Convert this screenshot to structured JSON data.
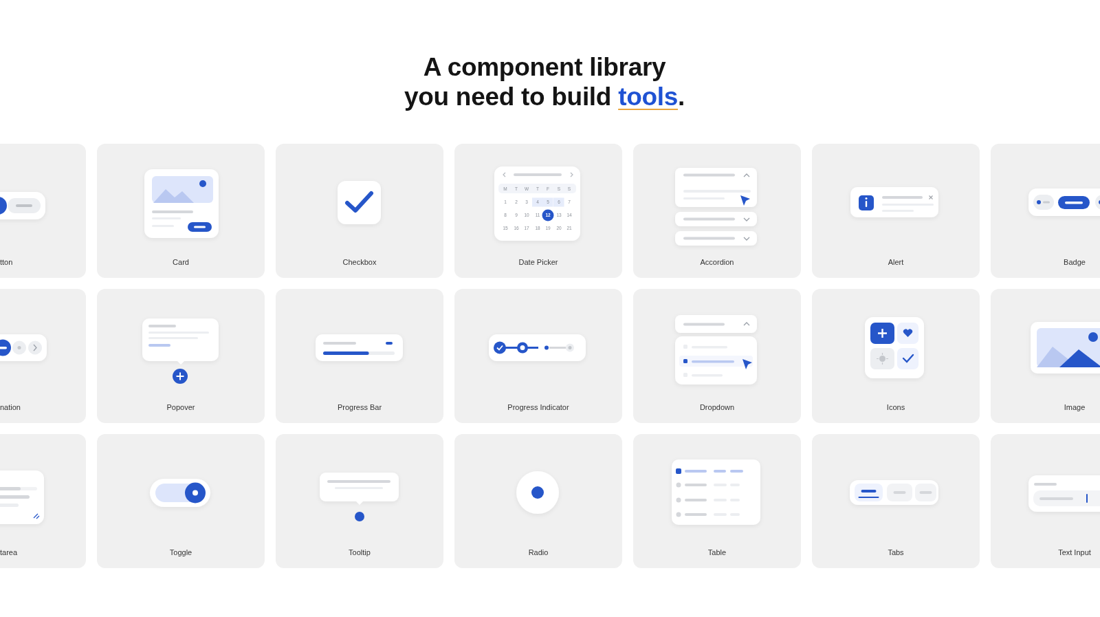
{
  "heading": "A component library\nyou need to build **tools**.",
  "tiles": [
    {
      "label": "tton",
      "kind": "button"
    },
    {
      "label": "Card",
      "kind": "card"
    },
    {
      "label": "Checkbox",
      "kind": "checkbox",
      "checked": true
    },
    {
      "label": "Date Picker",
      "kind": "datepicker",
      "weekdays": [
        "M",
        "T",
        "W",
        "T",
        "F",
        "S",
        "S"
      ],
      "days": [
        {
          "text": "1",
          "selected": false,
          "in_range": false
        },
        {
          "text": "2",
          "selected": false,
          "in_range": false
        },
        {
          "text": "3",
          "selected": false,
          "in_range": false
        },
        {
          "text": "4",
          "selected": false,
          "in_range": true
        },
        {
          "text": "5",
          "selected": false,
          "in_range": true
        },
        {
          "text": "6",
          "selected": false,
          "in_range": true
        },
        {
          "text": "7",
          "selected": false,
          "in_range": false
        },
        {
          "text": "8",
          "selected": false,
          "in_range": false
        },
        {
          "text": "9",
          "selected": false,
          "in_range": false
        },
        {
          "text": "10",
          "selected": false,
          "in_range": false
        },
        {
          "text": "11",
          "selected": false,
          "in_range": false
        },
        {
          "text": "12",
          "selected": true,
          "in_range": false
        },
        {
          "text": "13",
          "selected": false,
          "in_range": false
        },
        {
          "text": "14",
          "selected": false,
          "in_range": false
        },
        {
          "text": "15",
          "selected": false,
          "in_range": false
        },
        {
          "text": "16",
          "selected": false,
          "in_range": false
        },
        {
          "text": "17",
          "selected": false,
          "in_range": false
        },
        {
          "text": "18",
          "selected": false,
          "in_range": false
        },
        {
          "text": "19",
          "selected": false,
          "in_range": false
        },
        {
          "text": "20",
          "selected": false,
          "in_range": false
        },
        {
          "text": "21",
          "selected": false,
          "in_range": false
        }
      ]
    },
    {
      "label": "Accordion",
      "kind": "accordion",
      "sections": [
        {
          "expanded": true
        },
        {
          "expanded": false
        },
        {
          "expanded": false
        }
      ]
    },
    {
      "label": "Alert",
      "kind": "alert"
    },
    {
      "label": "Badge",
      "kind": "badge"
    },
    {
      "label": "nation",
      "kind": "pagination"
    },
    {
      "label": "Popover",
      "kind": "popover"
    },
    {
      "label": "Progress Bar",
      "kind": "progressbar",
      "level": 0.64
    },
    {
      "label": "Progress Indicator",
      "kind": "progressindicator"
    },
    {
      "label": "Dropdown",
      "kind": "dropdown"
    },
    {
      "label": "Icons",
      "kind": "icons"
    },
    {
      "label": "Image",
      "kind": "image"
    },
    {
      "label": "tarea",
      "kind": "textarea"
    },
    {
      "label": "Toggle",
      "kind": "toggle",
      "on": true
    },
    {
      "label": "Tooltip",
      "kind": "tooltip"
    },
    {
      "label": "Radio",
      "kind": "radio",
      "checked": true
    },
    {
      "label": "Table",
      "kind": "table"
    },
    {
      "label": "Tabs",
      "kind": "tabs",
      "tabs": [
        {
          "selected": true
        },
        {
          "selected": false
        },
        {
          "selected": false
        }
      ]
    },
    {
      "label": "Text Input",
      "kind": "textinput"
    }
  ]
}
